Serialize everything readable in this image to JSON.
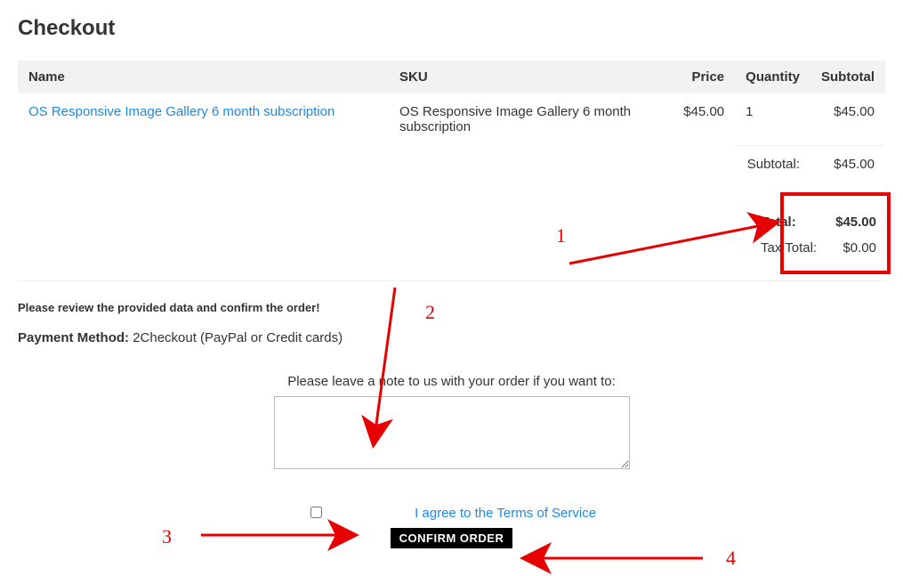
{
  "title": "Checkout",
  "headers": {
    "name": "Name",
    "sku": "SKU",
    "price": "Price",
    "qty": "Quantity",
    "subtotal": "Subtotal"
  },
  "item": {
    "name": "OS Responsive Image Gallery 6 month subscription",
    "sku": "OS Responsive Image Gallery 6 month subscription",
    "price": "$45.00",
    "qty": "1",
    "subtotal": "$45.00"
  },
  "subtotal_label": "Subtotal:",
  "subtotal_value": "$45.00",
  "totals": {
    "total_label": "Total:",
    "total_value": "$45.00",
    "tax_label": "Tax Total:",
    "tax_value": "$0.00"
  },
  "review_text": "Please review the provided data and confirm the order!",
  "payment": {
    "label": "Payment Method:",
    "value": " 2Checkout (PayPal or Credit cards)"
  },
  "note_label": "Please leave a note to us with your order if you want to:",
  "tos_text": "I agree to the Terms of Service",
  "confirm_label": "CONFIRM ORDER",
  "annot": {
    "n1": "1",
    "n2": "2",
    "n3": "3",
    "n4": "4"
  }
}
